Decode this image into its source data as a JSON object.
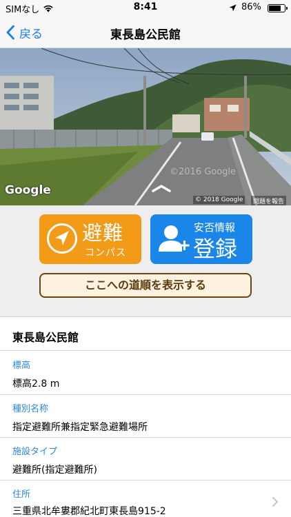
{
  "status": {
    "carrier": "SIMなし",
    "time": "8:41",
    "battery": "86%",
    "battery_level": 0.86
  },
  "nav": {
    "back_label": "戻る",
    "title": "東長島公民館"
  },
  "street_view": {
    "logo": "Google",
    "copyright": "© 2018 Google",
    "report": "問題を報告",
    "watermark": "©2016 Google"
  },
  "actions": {
    "compass_title": "避難",
    "compass_sub": "コンパス",
    "register_sub": "安否情報",
    "register_title": "登録",
    "route_label": "ここへの道順を表示する"
  },
  "details": {
    "name": "東長島公民館",
    "fields": [
      {
        "label": "標高",
        "value": "標高2.8 m"
      },
      {
        "label": "種別名称",
        "value": "指定避難所兼指定緊急避難場所"
      },
      {
        "label": "施設タイプ",
        "value": "避難所(指定避難所)"
      },
      {
        "label": "住所",
        "value": "三重県北牟婁郡紀北町東長島915-2"
      }
    ]
  },
  "colors": {
    "accent": "#1a7cf5",
    "compass_bg": "#f39a17",
    "register_bg": "#1a86ea",
    "label": "#2e87d6"
  }
}
